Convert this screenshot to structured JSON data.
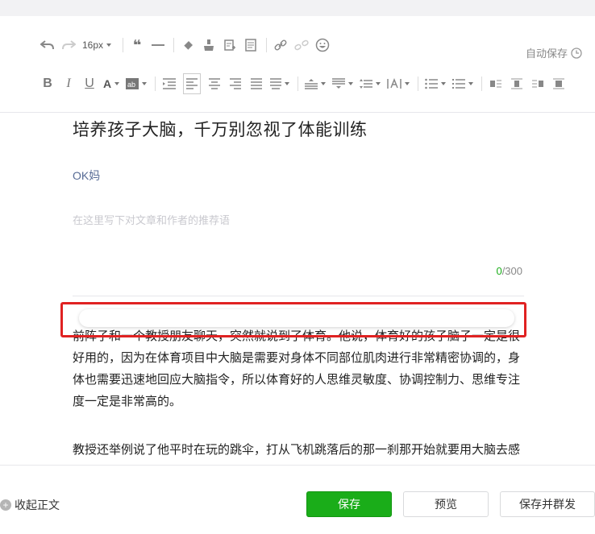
{
  "toolbar": {
    "font_size": "16px",
    "autosave": "自动保存"
  },
  "article": {
    "title": "培养孩子大脑，千万别忽视了体能训练",
    "author": "OK妈",
    "digest_placeholder": "在这里写下对文章和作者的推荐语",
    "count_current": "0",
    "count_max": "/300",
    "paragraphs": [
      "前阵子和一个教授朋友聊天，突然就说到了体育。他说，体育好的孩子脑子一定是很好用的，因为在体育项目中大脑是需要对身体不同部位肌肉进行非常精密协调的，身体也需要迅速地回应大脑指令，所以体育好的人思维灵敏度、协调控制力、思维专注度一定是非常高的。",
      "教授还举例说了他平时在玩的跳伞，打从飞机跳落后的那一刹那开始就要用大脑去感"
    ]
  },
  "footer": {
    "collapse": "收起正文",
    "save": "保存",
    "preview": "预览",
    "save_publish": "保存并群发"
  },
  "colors": {
    "accent_green": "#1aad19",
    "author_blue": "#576b95",
    "highlight_red": "#e02222"
  }
}
